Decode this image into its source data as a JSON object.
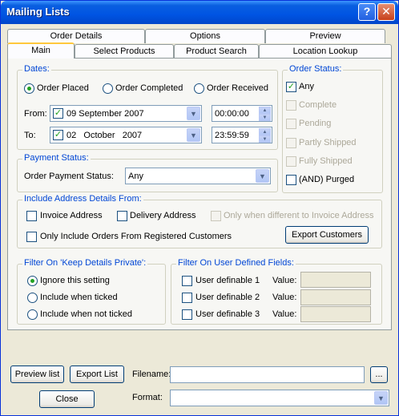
{
  "window": {
    "title": "Mailing Lists",
    "help_label": "?",
    "close_label": "✕"
  },
  "tabs": {
    "row1": [
      "Order Details",
      "Options",
      "Preview"
    ],
    "row2": [
      "Main",
      "Select Products",
      "Product Search",
      "Location Lookup"
    ]
  },
  "dates": {
    "title": "Dates:",
    "radios": [
      "Order Placed",
      "Order Completed",
      "Order Received"
    ],
    "selected": "Order Placed",
    "from_label": "From:",
    "from_date": "09 September 2007",
    "from_time": "00:00:00",
    "to_label": "To:",
    "to_date": "02   October   2007",
    "to_time": "23:59:59"
  },
  "order_status": {
    "title": "Order Status:",
    "items": [
      "Any",
      "Complete",
      "Pending",
      "Partly Shipped",
      "Fully Shipped",
      "(AND) Purged"
    ]
  },
  "payment": {
    "title": "Payment Status:",
    "label": "Order Payment Status:",
    "value": "Any"
  },
  "address": {
    "title": "Include Address Details From:",
    "invoice": "Invoice Address",
    "delivery": "Delivery Address",
    "only_when": "Only when different to Invoice Address",
    "registered": "Only Include Orders From Registered Customers",
    "export_btn": "Export Customers"
  },
  "private": {
    "title": "Filter On 'Keep Details Private':",
    "options": [
      "Ignore this setting",
      "Include when ticked",
      "Include when not ticked"
    ],
    "selected": "Ignore this setting"
  },
  "user_fields": {
    "title": "Filter On User Defined Fields:",
    "items": [
      "User definable 1",
      "User definable 2",
      "User definable 3"
    ],
    "value_label": "Value:"
  },
  "footer": {
    "preview_btn": "Preview list",
    "export_btn": "Export List",
    "close_btn": "Close",
    "filename_label": "Filename:",
    "filename_value": "",
    "browse_btn": "...",
    "format_label": "Format:",
    "format_value": ""
  },
  "icons": {
    "check": "checkmark-icon",
    "dropdown": "chevron-down-icon"
  },
  "colors": {
    "group_title": "#0046d5",
    "title_bar": "#0054e3",
    "check_mark": "#21a121"
  }
}
